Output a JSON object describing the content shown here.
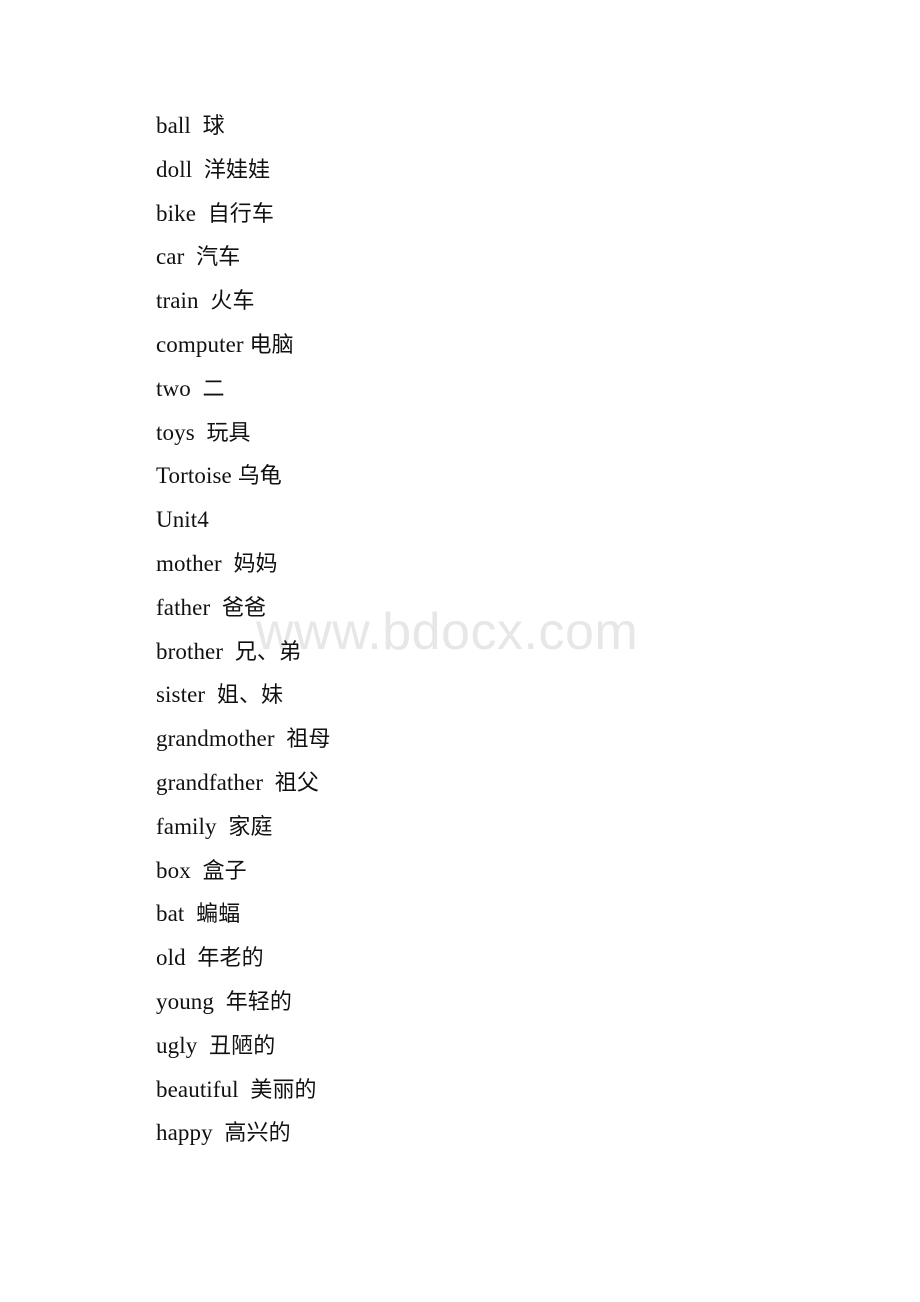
{
  "page": {
    "background_color": "#ffffff",
    "text_color": "#111111"
  },
  "watermark": {
    "text": "www.bdocx.com",
    "color": "#e7e7e7"
  },
  "document": {
    "lines": [
      {
        "english": "ball",
        "gap": "  ",
        "chinese": "球"
      },
      {
        "english": "doll",
        "gap": "  ",
        "chinese": "洋娃娃"
      },
      {
        "english": "bike",
        "gap": "  ",
        "chinese": "自行车"
      },
      {
        "english": "car",
        "gap": "  ",
        "chinese": "汽车"
      },
      {
        "english": "train",
        "gap": "  ",
        "chinese": "火车"
      },
      {
        "english": "computer",
        "gap": " ",
        "chinese": "电脑"
      },
      {
        "english": "two",
        "gap": "  ",
        "chinese": "二"
      },
      {
        "english": "toys",
        "gap": "  ",
        "chinese": "玩具"
      },
      {
        "english": "Tortoise",
        "gap": " ",
        "chinese": "乌龟"
      },
      {
        "english": "Unit4",
        "gap": "",
        "chinese": ""
      },
      {
        "english": "mother",
        "gap": "  ",
        "chinese": "妈妈"
      },
      {
        "english": "father",
        "gap": "  ",
        "chinese": "爸爸"
      },
      {
        "english": "brother",
        "gap": "  ",
        "chinese": "兄、弟"
      },
      {
        "english": "sister",
        "gap": "  ",
        "chinese": "姐、妹"
      },
      {
        "english": "grandmother",
        "gap": "  ",
        "chinese": "祖母"
      },
      {
        "english": "grandfather",
        "gap": "  ",
        "chinese": "祖父"
      },
      {
        "english": "family",
        "gap": "  ",
        "chinese": "家庭"
      },
      {
        "english": "box",
        "gap": "  ",
        "chinese": "盒子"
      },
      {
        "english": "bat",
        "gap": "  ",
        "chinese": "蝙蝠"
      },
      {
        "english": "old",
        "gap": "  ",
        "chinese": "年老的"
      },
      {
        "english": "young",
        "gap": "  ",
        "chinese": "年轻的"
      },
      {
        "english": "ugly",
        "gap": "  ",
        "chinese": "丑陋的"
      },
      {
        "english": "beautiful",
        "gap": "  ",
        "chinese": "美丽的"
      },
      {
        "english": "happy",
        "gap": "  ",
        "chinese": "高兴的"
      }
    ]
  }
}
